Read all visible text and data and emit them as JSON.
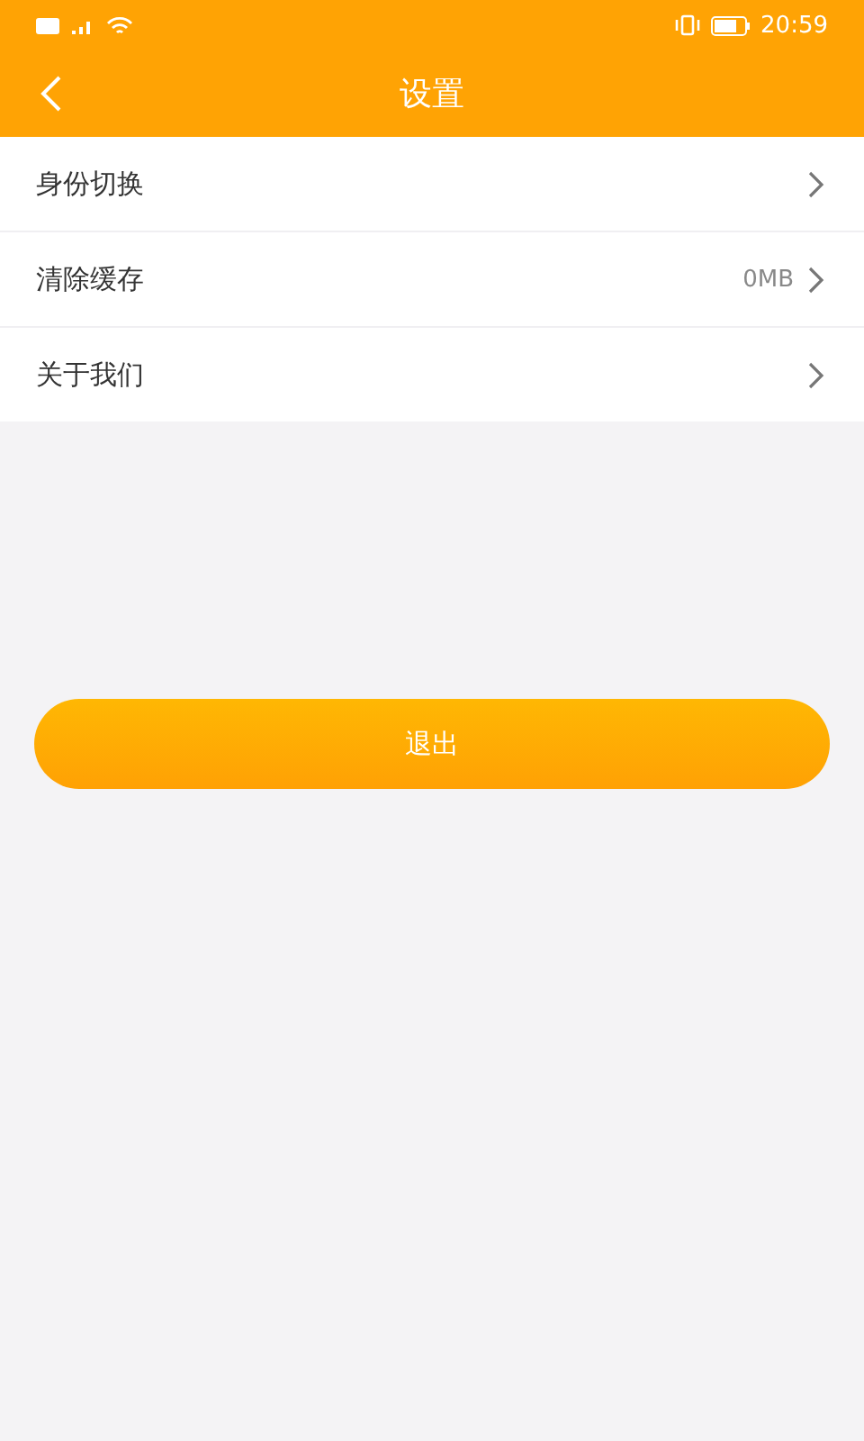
{
  "status_bar": {
    "time": "20:59"
  },
  "header": {
    "title": "设置"
  },
  "settings": [
    {
      "label": "身份切换"
    },
    {
      "label": "清除缓存",
      "value": "0MB"
    },
    {
      "label": "关于我们"
    }
  ],
  "logout_button": {
    "label": "退出"
  }
}
